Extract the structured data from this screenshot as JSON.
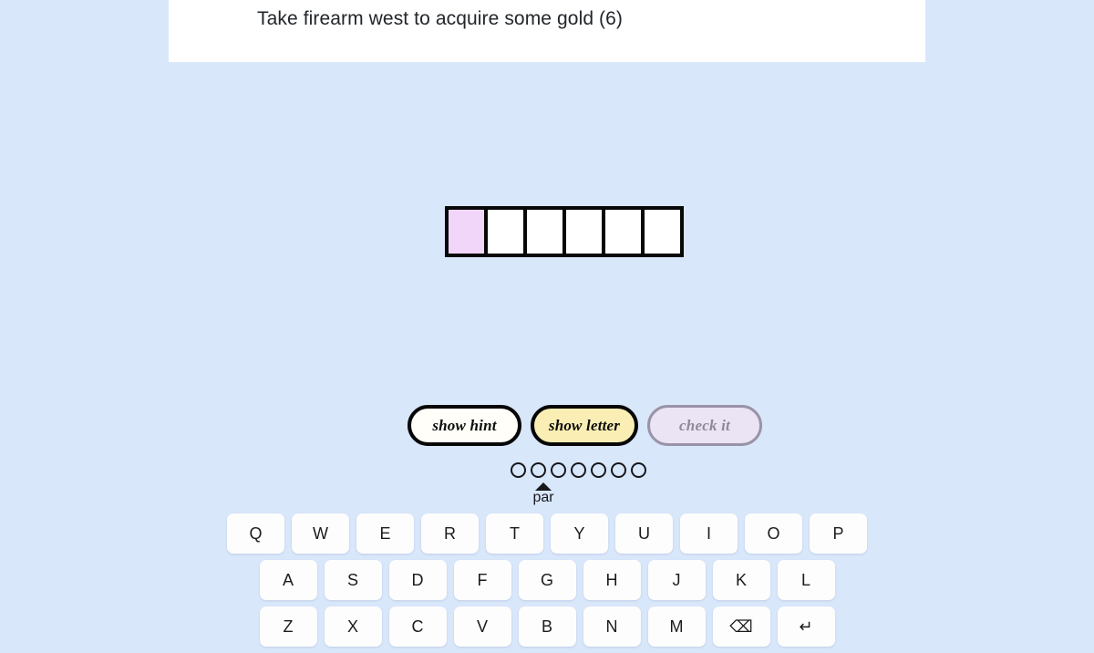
{
  "background_color": "#d9e7fb",
  "clue": {
    "text": "Take firearm west to acquire some gold (6)",
    "panel_color": "#ffffff"
  },
  "answer_grid": {
    "length": 6,
    "active_index": 0,
    "active_color": "#f2d6fa",
    "cells": [
      {
        "letter": "",
        "state": "active"
      },
      {
        "letter": "",
        "state": "empty"
      },
      {
        "letter": "",
        "state": "empty"
      },
      {
        "letter": "",
        "state": "empty"
      },
      {
        "letter": "",
        "state": "empty"
      },
      {
        "letter": "",
        "state": "empty"
      }
    ]
  },
  "actions": {
    "show_hint_label": "show hint",
    "show_letter_label": "show letter",
    "check_it_label": "check it",
    "show_letter_color": "#faeeb4",
    "check_it_color": "#eae4f5",
    "check_it_text_color": "#8e8898"
  },
  "score": {
    "total": 7,
    "used": 0,
    "par_index": 1,
    "par_label": "par",
    "circles": [
      "empty",
      "empty",
      "empty",
      "empty",
      "empty",
      "empty",
      "empty"
    ]
  },
  "keyboard": {
    "rows": [
      {
        "keys": [
          "Q",
          "W",
          "E",
          "R",
          "T",
          "Y",
          "U",
          "I",
          "O",
          "P"
        ]
      },
      {
        "keys": [
          "A",
          "S",
          "D",
          "F",
          "G",
          "H",
          "J",
          "K",
          "L"
        ]
      },
      {
        "keys": [
          "Z",
          "X",
          "C",
          "V",
          "B",
          "N",
          "M",
          "⌫",
          "↵"
        ]
      }
    ]
  }
}
